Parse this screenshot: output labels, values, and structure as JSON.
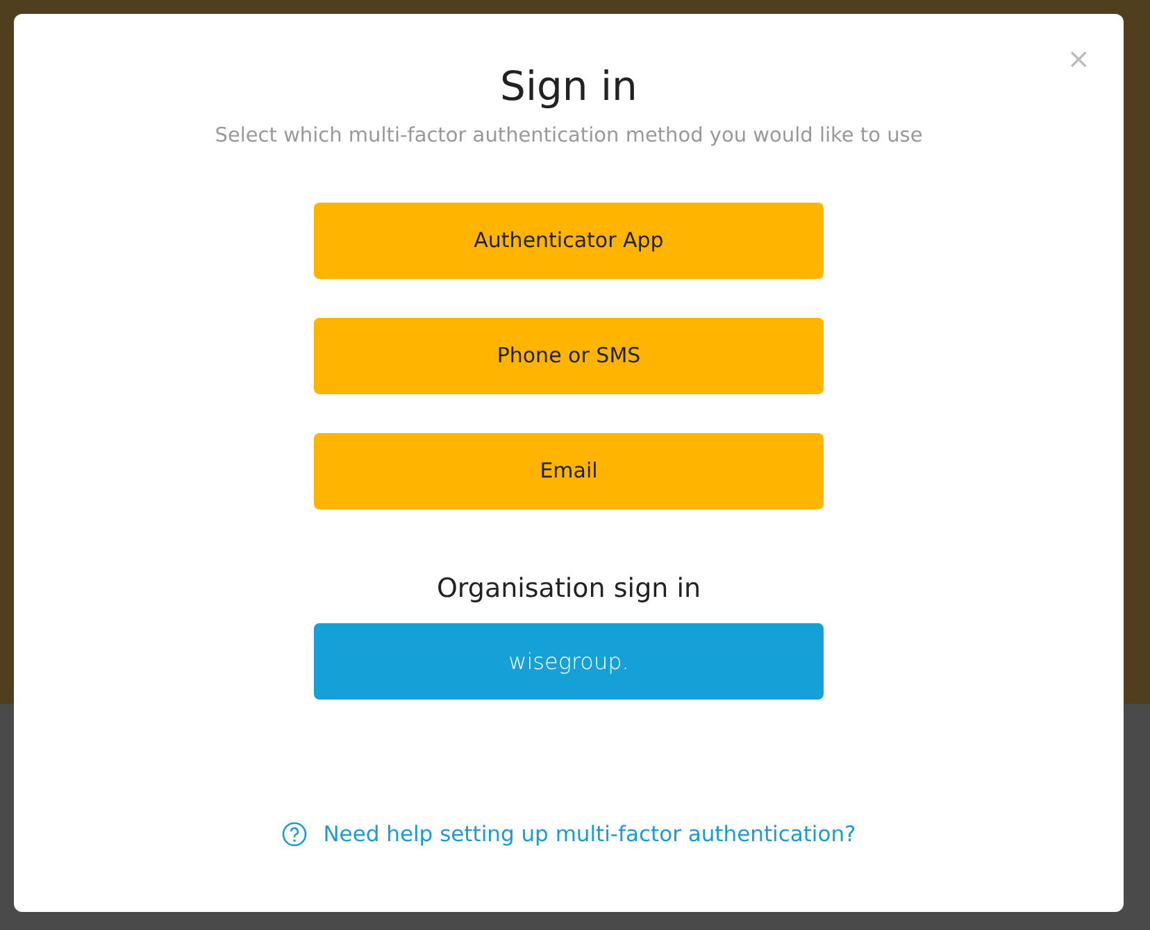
{
  "dialog": {
    "title": "Sign in",
    "subtitle": "Select which multi-factor authentication method you would like to use",
    "close": "×",
    "methods": [
      "Authenticator App",
      "Phone or SMS",
      "Email"
    ],
    "organisation": {
      "heading": "Organisation sign in",
      "button": "wisegroup."
    },
    "help_link": "Need help setting up multi-factor authentication?"
  }
}
